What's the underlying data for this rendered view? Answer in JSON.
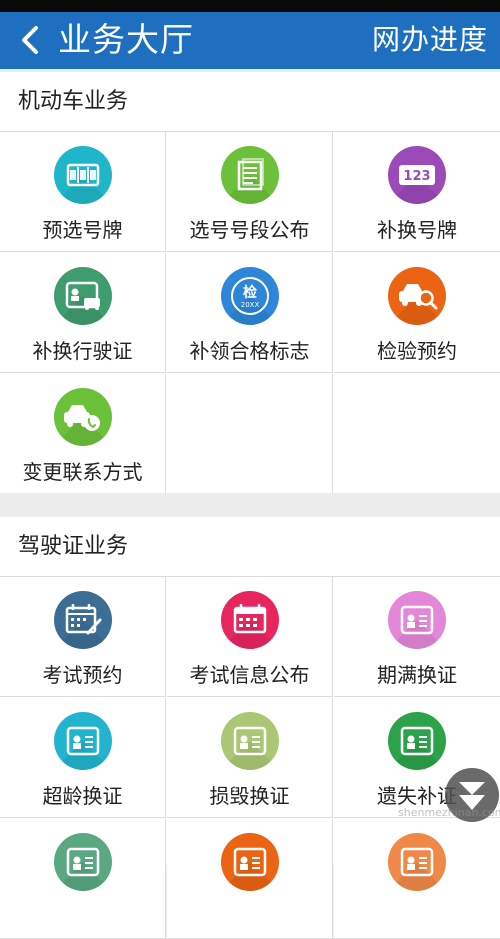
{
  "header": {
    "title": "业务大厅",
    "progress_label": "网办进度"
  },
  "vehicle": {
    "title": "机动车业务",
    "items": [
      {
        "label": "预选号牌",
        "icon": "plate-select-icon",
        "color": "#1fb6c9"
      },
      {
        "label": "选号号段公布",
        "icon": "document-icon",
        "color": "#6cc13b"
      },
      {
        "label": "补换号牌",
        "icon": "plate-123-icon",
        "color": "#9b4ab8"
      },
      {
        "label": "补换行驶证",
        "icon": "license-car-icon",
        "color": "#3f9c6e"
      },
      {
        "label": "补领合格标志",
        "icon": "inspection-badge-icon",
        "color": "#2d86d8"
      },
      {
        "label": "检验预约",
        "icon": "car-search-icon",
        "color": "#ea6413"
      },
      {
        "label": "变更联系方式",
        "icon": "car-phone-icon",
        "color": "#6cc13b"
      }
    ]
  },
  "license": {
    "title": "驾驶证业务",
    "items": [
      {
        "label": "考试预约",
        "icon": "calendar-pen-icon",
        "color": "#3c6e95"
      },
      {
        "label": "考试信息公布",
        "icon": "calendar-icon",
        "color": "#e8265e"
      },
      {
        "label": "期满换证",
        "icon": "license-card-icon",
        "color": "#e487d8"
      },
      {
        "label": "超龄换证",
        "icon": "license-card-icon",
        "color": "#22b4cf"
      },
      {
        "label": "损毁换证",
        "icon": "license-card-icon",
        "color": "#a9c774"
      },
      {
        "label": "遗失补证",
        "icon": "license-card-icon",
        "color": "#2ca24a"
      },
      {
        "label": "",
        "icon": "license-card-icon",
        "color": "#5aa882"
      },
      {
        "label": "",
        "icon": "license-card-icon",
        "color": "#ea6413"
      },
      {
        "label": "",
        "icon": "license-card-icon",
        "color": "#f08848"
      }
    ]
  },
  "badge_text": {
    "top": "检",
    "bottom": "20XX"
  },
  "plate_digits": "123",
  "watermark": "shenmezhinan.com"
}
